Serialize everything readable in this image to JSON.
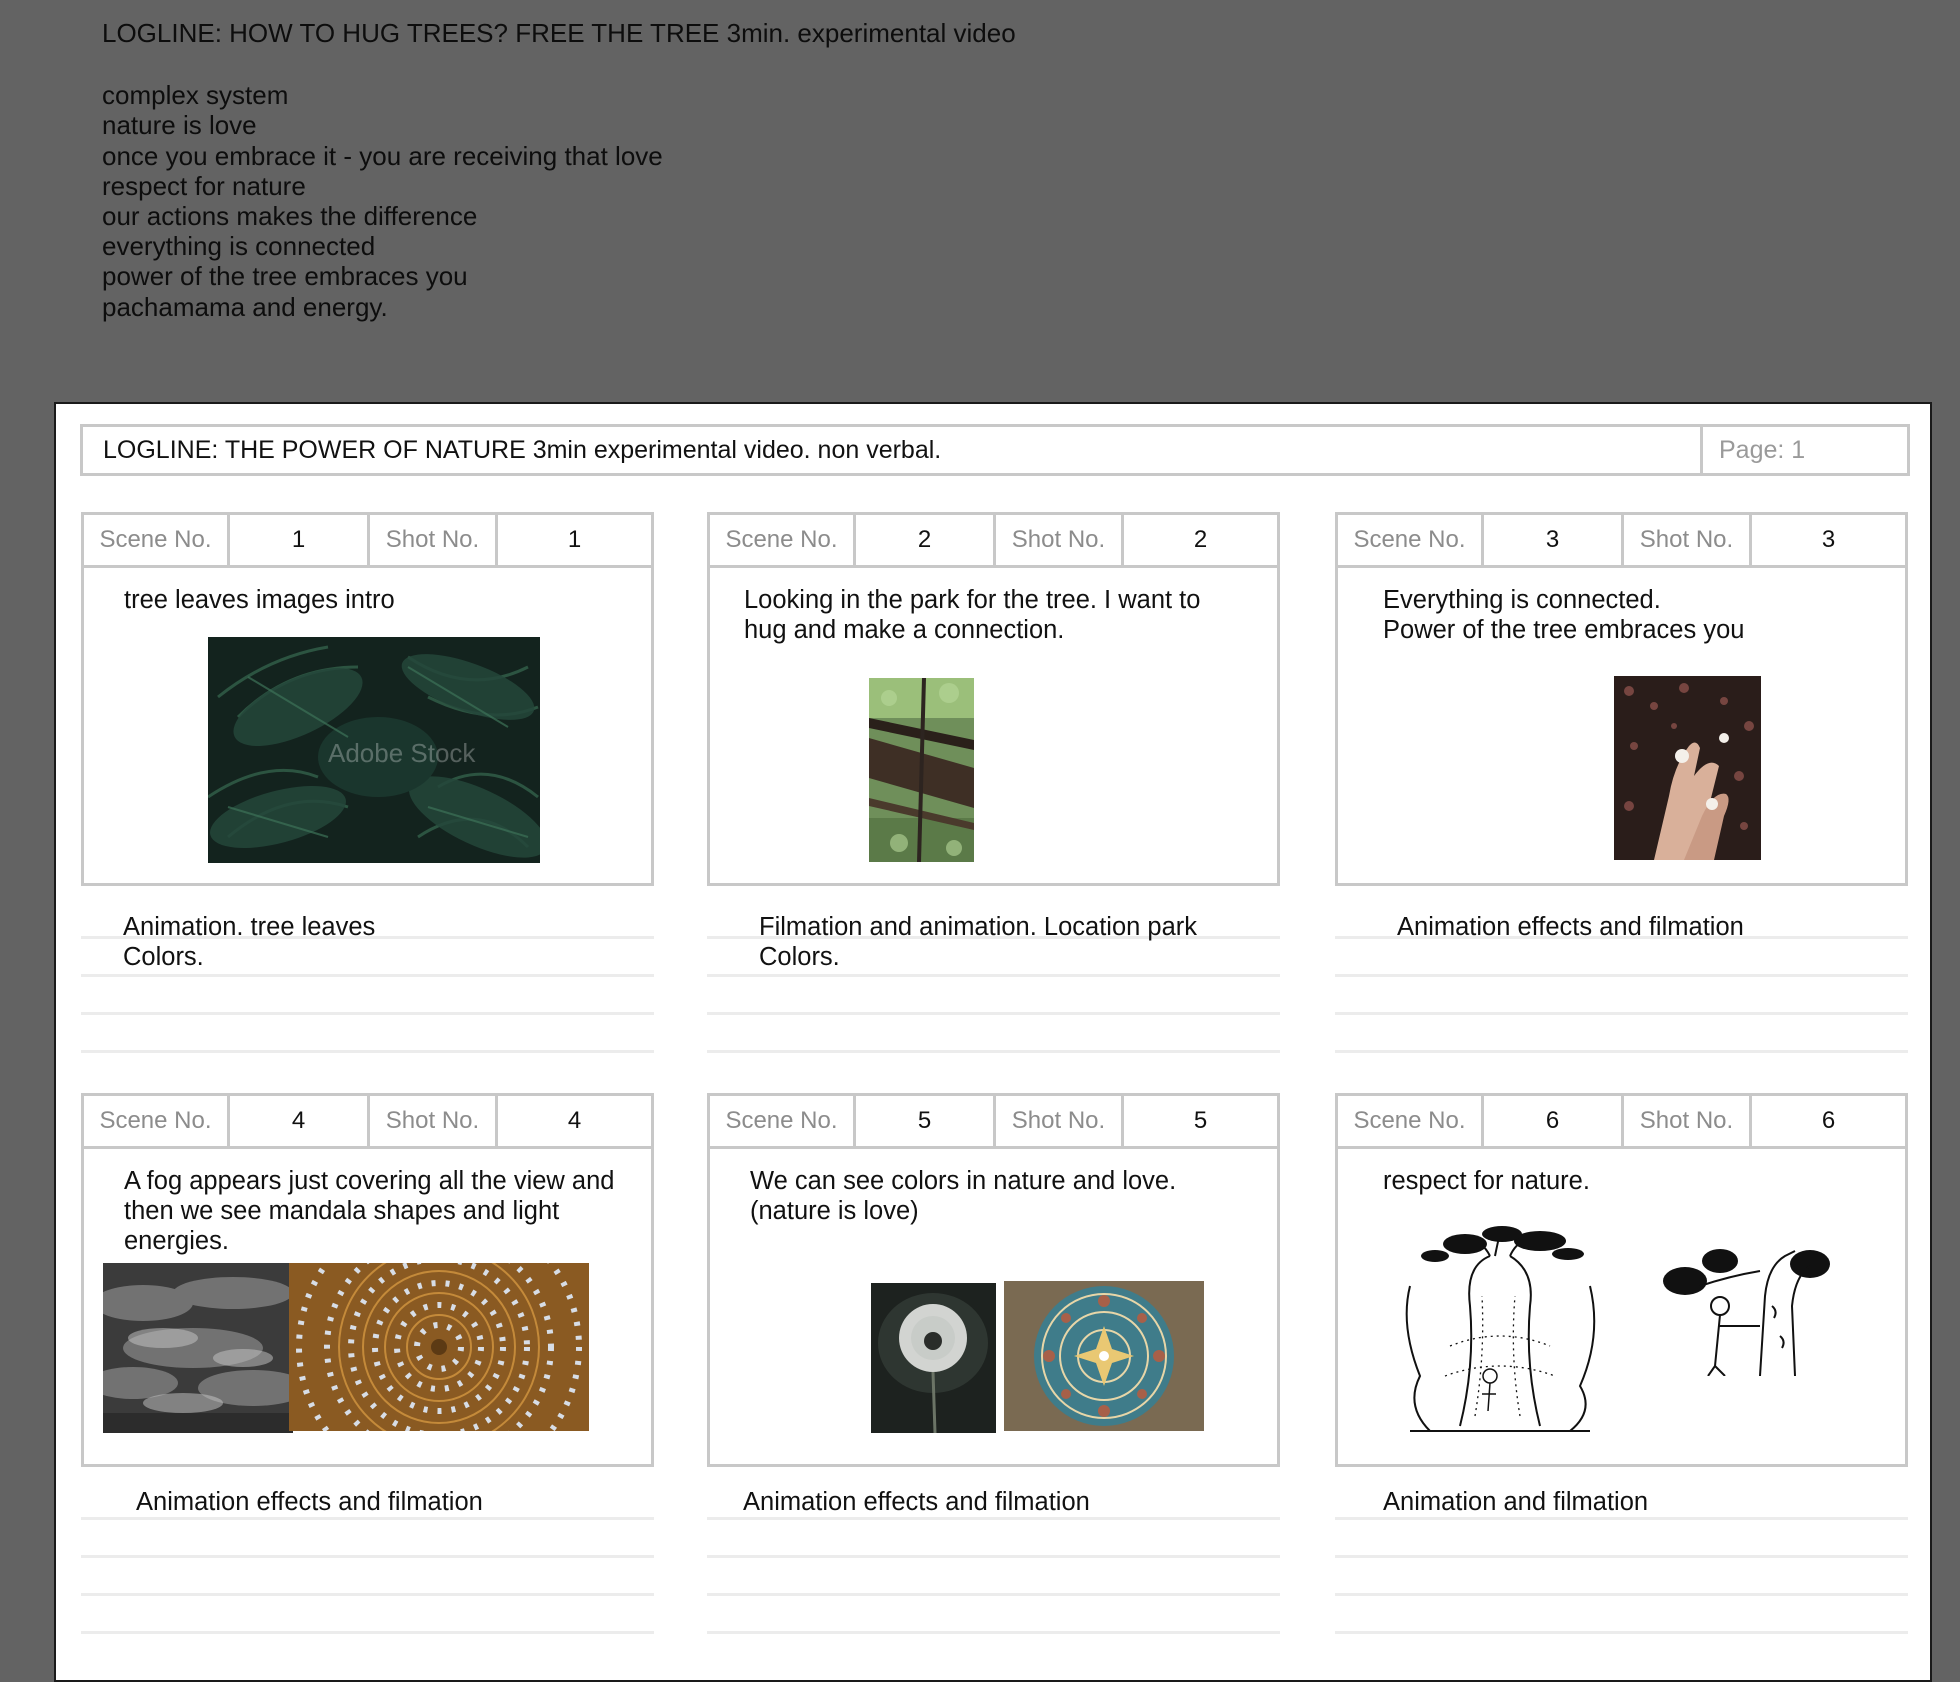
{
  "top_notes": {
    "logline": "LOGLINE: HOW TO HUG TREES? FREE THE TREE 3min. experimental video",
    "lines": [
      "complex system",
      "nature is love",
      "once you embrace it - you are receiving that love",
      "respect for nature",
      "our actions makes the difference",
      "everything is connected",
      "power of the tree embraces you",
      "pachamama and energy."
    ]
  },
  "sheet": {
    "logline": "LOGLINE: THE POWER OF NATURE 3min experimental video. non verbal.",
    "page": "Page: 1"
  },
  "labels": {
    "scene": "Scene No.",
    "shot": "Shot No."
  },
  "panels": [
    {
      "scene": "1",
      "shot": "1",
      "description": [
        "tree leaves images intro"
      ],
      "action": [
        "Animation. tree leaves",
        "Colors."
      ],
      "images": [
        "tropical-leaves-image"
      ],
      "watermark": "Adobe Stock"
    },
    {
      "scene": "2",
      "shot": "2",
      "description": [
        "Looking in the park for the tree. I want to",
        "hug and make a connection."
      ],
      "action": [
        "Filmation and animation. Location park",
        "Colors."
      ],
      "images": [
        "tree-trunk-image"
      ]
    },
    {
      "scene": "3",
      "shot": "3",
      "description": [
        "Everything is connected.",
        "Power of the tree embraces you"
      ],
      "action": [
        "Animation effects and filmation"
      ],
      "images": [
        "hands-flowers-image"
      ]
    },
    {
      "scene": "4",
      "shot": "4",
      "description": [
        "A fog appears just covering all the view and",
        "then we see mandala shapes and light",
        "energies."
      ],
      "action": [
        "Animation effects and filmation"
      ],
      "images": [
        "clouds-image",
        "mandala-image"
      ]
    },
    {
      "scene": "5",
      "shot": "5",
      "description": [
        "We can see colors in nature and love.",
        "(nature is love)"
      ],
      "action": [
        "Animation effects and filmation"
      ],
      "images": [
        "dandelion-image",
        "tile-mandala-image"
      ]
    },
    {
      "scene": "6",
      "shot": "6",
      "description": [
        "respect for nature."
      ],
      "action": [
        "Animation and filmation"
      ],
      "images": [
        "tree-sketch-image",
        "tree-hug-sketch-image"
      ]
    }
  ],
  "colors": {
    "background": "#636363",
    "sheet": "#ffffff",
    "frame_border": "#c8c8c8",
    "label_text": "#8c8c8c"
  }
}
